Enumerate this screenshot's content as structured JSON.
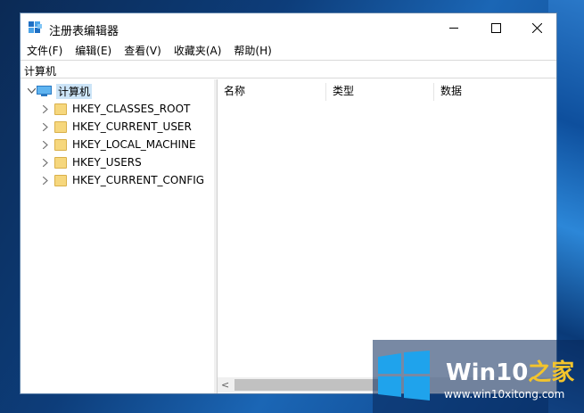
{
  "window": {
    "title": "注册表编辑器",
    "controls": {
      "minimize": "minimize-icon",
      "maximize": "maximize-icon",
      "close": "✕"
    }
  },
  "menu": [
    "文件(F)",
    "编辑(E)",
    "查看(V)",
    "收藏夹(A)",
    "帮助(H)"
  ],
  "address": "计算机",
  "tree": {
    "root": "计算机",
    "children": [
      "HKEY_CLASSES_ROOT",
      "HKEY_CURRENT_USER",
      "HKEY_LOCAL_MACHINE",
      "HKEY_USERS",
      "HKEY_CURRENT_CONFIG"
    ]
  },
  "list": {
    "columns": [
      "名称",
      "类型",
      "数据"
    ]
  },
  "watermark": {
    "title_part1": "Win10",
    "title_part2": "之家",
    "url": "www.win10xitong.com"
  },
  "colors": {
    "accent": "#0078d7",
    "selection": "#cce4f7",
    "folder": "#f6d77d"
  }
}
